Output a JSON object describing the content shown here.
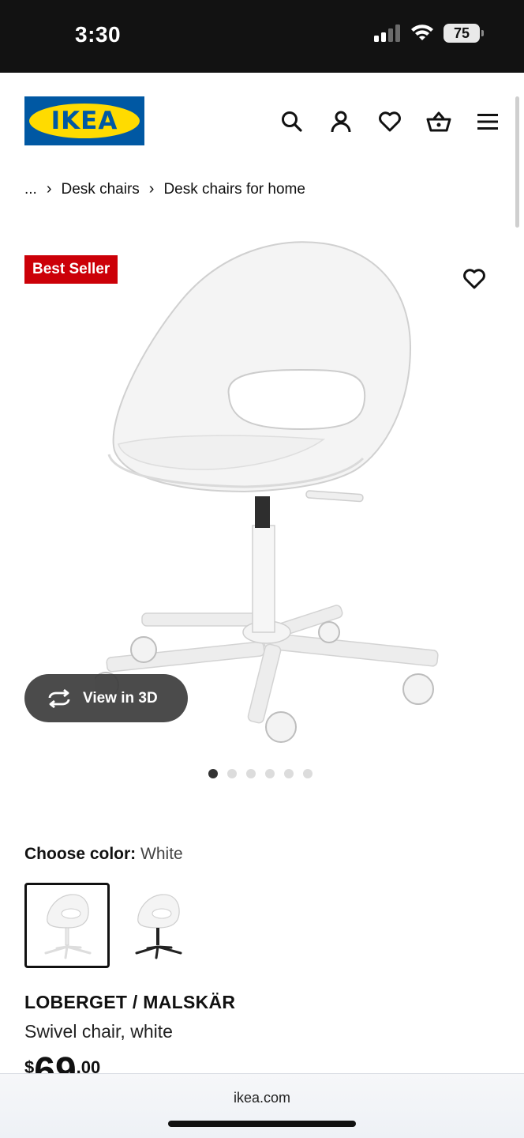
{
  "status_bar": {
    "time": "3:30",
    "battery": "75",
    "icons": [
      "signal-icon",
      "wifi-icon",
      "battery-icon"
    ]
  },
  "header": {
    "logo_text": "IKEA",
    "icons": [
      "search-icon",
      "account-icon",
      "heart-icon",
      "basket-icon",
      "menu-icon"
    ],
    "brand_colors": {
      "blue": "#0058a3",
      "yellow": "#ffdb00"
    }
  },
  "breadcrumb": {
    "ellipsis": "...",
    "items": [
      "Desk chairs",
      "Desk chairs for home"
    ]
  },
  "product_image": {
    "badge": "Best Seller",
    "badge_color": "#cc0008",
    "view3d_label": "View in 3D",
    "carousel": {
      "total": 6,
      "active_index": 0
    }
  },
  "color_choice": {
    "label": "Choose color:",
    "selected": "White",
    "options": [
      "White",
      "White/black"
    ]
  },
  "product": {
    "name": "LOBERGET / MALSKÄR",
    "description": "Swivel chair, white",
    "price": {
      "currency": "$",
      "main": "69",
      "cents": ".00"
    }
  },
  "browser": {
    "url": "ikea.com"
  }
}
